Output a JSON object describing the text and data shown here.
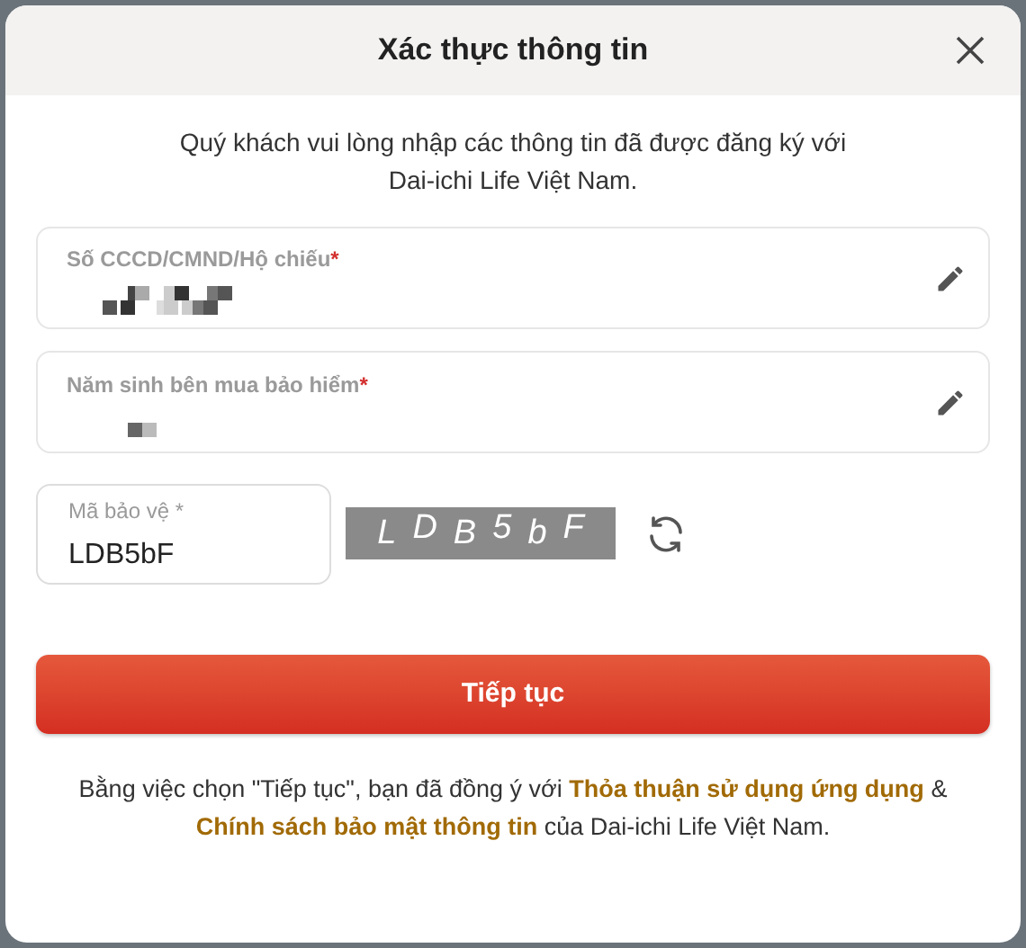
{
  "dialog": {
    "title": "Xác thực thông tin"
  },
  "intro": [
    "Quý khách vui lòng nhập các thông tin đã được đăng ký với",
    "Dai-ichi Life Việt Nam."
  ],
  "fields": [
    {
      "kind": "masked",
      "label": "Số CCCD/CMND/Hộ chiếu",
      "required_mark": "*"
    },
    {
      "kind": "masked_short",
      "label": "Năm sinh bên mua bảo hiểm",
      "required_mark": "*"
    }
  ],
  "captcha": {
    "label": "Mã bảo vệ *",
    "value": "LDB5bF",
    "image_chars": [
      "L",
      "D",
      "B",
      "5",
      "b",
      "F"
    ]
  },
  "submit": {
    "label": "Tiếp tục"
  },
  "footer": {
    "before": "Bằng việc chọn \"Tiếp tục\", bạn đã đồng ý với ",
    "link_1": "Thỏa thuận sử dụng ứng dụng",
    "middle": " &",
    "link_2": "Chính sách bảo mật thông tin",
    "after": " của Dai-ichi Life Việt Nam."
  }
}
